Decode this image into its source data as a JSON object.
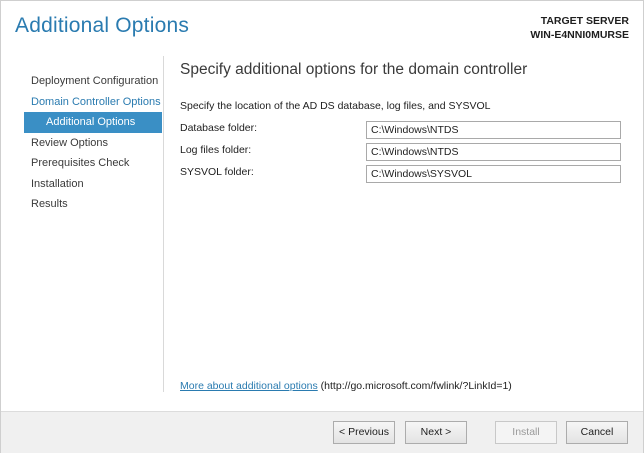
{
  "window": {
    "title": "Additional Options"
  },
  "target_server": {
    "label": "TARGET SERVER",
    "name": "WIN-E4NNI0MURSE"
  },
  "nav": {
    "items": [
      {
        "label": "Deployment Configuration",
        "state": "normal"
      },
      {
        "label": "Domain Controller Options",
        "state": "parent"
      },
      {
        "label": "Additional Options",
        "state": "selected"
      },
      {
        "label": "Review Options",
        "state": "normal"
      },
      {
        "label": "Prerequisites Check",
        "state": "normal"
      },
      {
        "label": "Installation",
        "state": "normal"
      },
      {
        "label": "Results",
        "state": "normal"
      }
    ]
  },
  "content": {
    "heading": "Specify additional options for the domain controller",
    "instruction": "Specify the location of the AD DS database, log files, and SYSVOL",
    "fields": [
      {
        "label": "Database folder:",
        "value": "C:\\Windows\\NTDS"
      },
      {
        "label": "Log files folder:",
        "value": "C:\\Windows\\NTDS"
      },
      {
        "label": "SYSVOL folder:",
        "value": "C:\\Windows\\SYSVOL"
      }
    ],
    "more_link": "More about additional options",
    "more_url": " (http://go.microsoft.com/fwlink/?LinkId=1)"
  },
  "footer": {
    "previous": "< Previous",
    "next": "Next >",
    "install": "Install",
    "cancel": "Cancel"
  },
  "colors": {
    "accent": "#2a7bb0",
    "selected_bg": "#3a8fc5",
    "footer_bg": "#f0f0f0"
  }
}
